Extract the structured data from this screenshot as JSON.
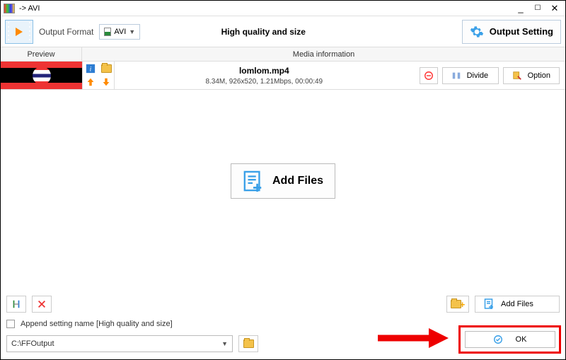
{
  "window": {
    "title": "-> AVI"
  },
  "toolbar": {
    "format_label": "Output Format",
    "format_value": "AVI",
    "profile": "High quality and size",
    "output_setting": "Output Setting"
  },
  "headers": {
    "preview": "Preview",
    "media": "Media information"
  },
  "file": {
    "name": "lomlom.mp4",
    "meta": "8.34M, 926x520, 1.21Mbps, 00:00:49",
    "divide": "Divide",
    "option": "Option"
  },
  "center": {
    "add_files": "Add Files"
  },
  "bottom": {
    "append_setting": "Append setting name [High quality and size]",
    "output_path": "C:\\FFOutput",
    "add_files": "Add Files",
    "ok": "OK"
  }
}
